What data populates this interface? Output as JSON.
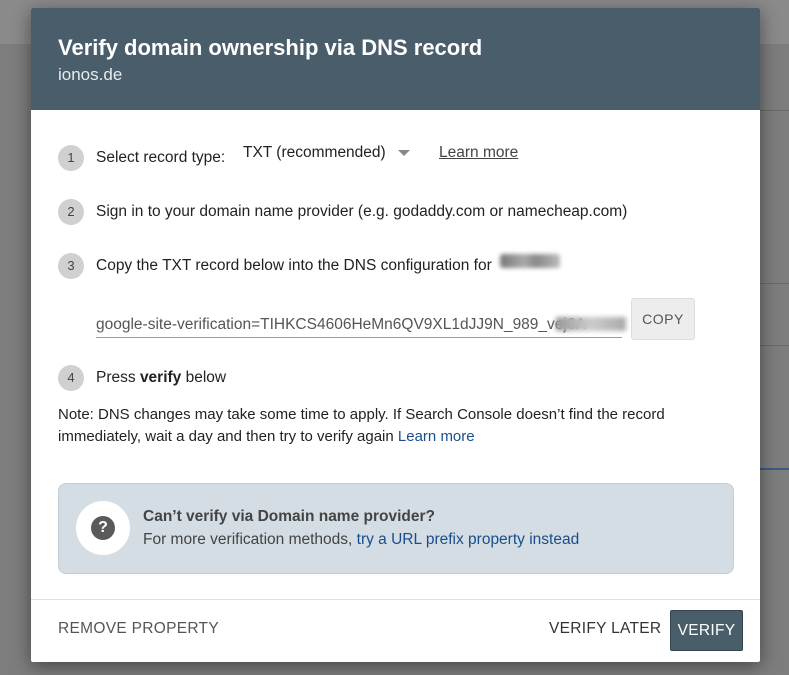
{
  "dialog": {
    "title": "Verify domain ownership via DNS record",
    "subtitle": "ionos.de"
  },
  "steps": [
    {
      "num": "1",
      "text": "Select record type:"
    },
    {
      "num": "2",
      "text": "Sign in to your domain name provider (e.g. godaddy.com or namecheap.com)"
    },
    {
      "num": "3",
      "text": "Copy the TXT record below into the DNS configuration for"
    },
    {
      "num": "4",
      "text_prefix": "Press ",
      "text_bold": "verify",
      "text_suffix": " below"
    }
  ],
  "record_type": {
    "selected": "TXT (recommended)",
    "learn_more": "Learn more"
  },
  "record": {
    "value": "google-site-verification=TIHKCS4606HeMn6QV9XL1dJJ9N_989_vej6A",
    "copy_label": "COPY"
  },
  "note": {
    "text": "Note: DNS changes may take some time to apply. If Search Console doesn’t find the record immediately, wait a day and then try to verify again",
    "link": "Learn more"
  },
  "alternative": {
    "title": "Can’t verify via Domain name provider?",
    "desc": "For more verification methods,",
    "link": "try a URL prefix property instead"
  },
  "footer": {
    "remove": "REMOVE PROPERTY",
    "later": "VERIFY LATER",
    "verify": "VERIFY"
  },
  "colors": {
    "header_bg": "#4a5d6a",
    "link": "#1a4e8a",
    "info_box_bg": "#d3dde3"
  },
  "icons": {
    "help": "question-circle-icon",
    "caret": "dropdown-caret-icon"
  }
}
